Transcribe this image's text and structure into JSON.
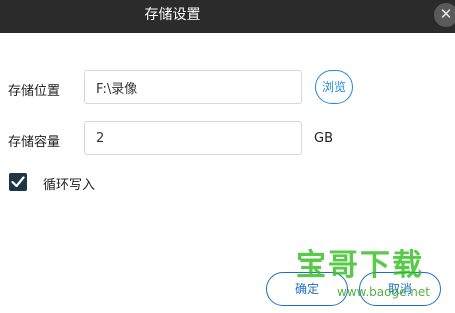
{
  "window": {
    "title": "存储设置",
    "close_symbol": "✕"
  },
  "form": {
    "location_label": "存储位置",
    "location_value": "F:\\录像",
    "browse_label": "浏览",
    "capacity_label": "存储容量",
    "capacity_value": "2",
    "capacity_unit": "GB",
    "loop_write_label": "循环写入",
    "loop_write_checked": true
  },
  "footer": {
    "ok_label": "确定",
    "cancel_label": "取消"
  },
  "watermark": {
    "text": "宝哥下载",
    "url": "www.baoge.net"
  },
  "icons": {
    "close": "close-icon",
    "check": "check-icon"
  },
  "colors": {
    "titlebar": "#2b2b2b",
    "accent": "#1e8be0",
    "checkbox": "#1f3447"
  }
}
